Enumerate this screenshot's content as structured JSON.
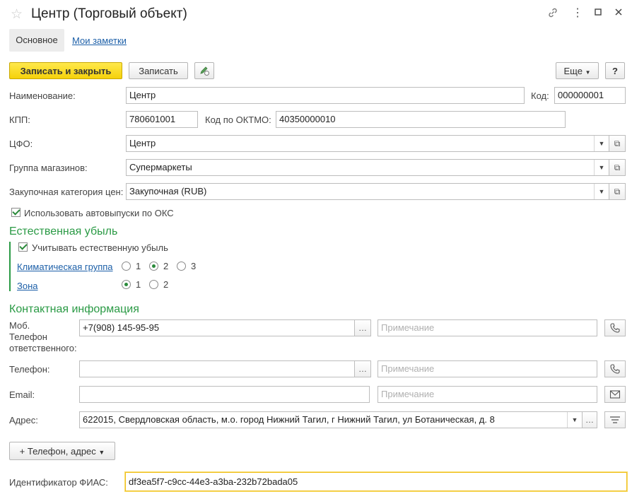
{
  "window": {
    "title": "Центр (Торговый объект)"
  },
  "tabs": [
    {
      "label": "Основное"
    },
    {
      "label": "Мои заметки"
    }
  ],
  "toolbar": {
    "save_close": "Записать и закрыть",
    "save": "Записать",
    "more": "Еще",
    "help": "?"
  },
  "fields": {
    "name": {
      "label": "Наименование:",
      "value": "Центр"
    },
    "code": {
      "label": "Код:",
      "value": "000000001"
    },
    "kpp": {
      "label": "КПП:",
      "value": "780601001"
    },
    "oktmo": {
      "label": "Код по ОКТМО:",
      "value": "40350000010"
    },
    "cfo": {
      "label": "ЦФО:",
      "value": "Центр"
    },
    "store_group": {
      "label": "Группа магазинов:",
      "value": "Супермаркеты"
    },
    "price_category": {
      "label": "Закупочная категория цен:",
      "value": "Закупочная (RUB)"
    },
    "autorelease": {
      "label": "Использовать автовыпуски по ОКС",
      "checked": true
    }
  },
  "natural_loss": {
    "title": "Естественная убыль",
    "consider": {
      "label": "Учитывать естественную убыль",
      "checked": true
    },
    "climate": {
      "label": "Климатическая группа",
      "options": [
        "1",
        "2",
        "3"
      ],
      "selected": "2"
    },
    "zone": {
      "label": "Зона",
      "options": [
        "1",
        "2"
      ],
      "selected": "1"
    }
  },
  "contact": {
    "title": "Контактная информация",
    "mobile": {
      "label_line1": "Моб.",
      "label_line2": "Телефон",
      "label_line3": "ответственного:",
      "value": "+7(908) 145-95-95",
      "note_placeholder": "Примечание"
    },
    "phone": {
      "label": "Телефон:",
      "value": "",
      "note_placeholder": "Примечание"
    },
    "email": {
      "label": "Email:",
      "value": "",
      "note_placeholder": "Примечание"
    },
    "address": {
      "label": "Адрес:",
      "value": "622015, Свердловская область, м.о. город Нижний Тагил, г Нижний Тагил, ул Ботаническая, д. 8"
    },
    "add_button": "+ Телефон, адрес"
  },
  "fias": {
    "label": "Идентификатор ФИАС:",
    "value": "df3ea5f7-c9cc-44e3-a3ba-232b72bada05"
  },
  "accent_colors": {
    "section_green": "#2a9a45",
    "link_blue": "#1c5fa8",
    "primary_yellow": "#f5d10a"
  }
}
